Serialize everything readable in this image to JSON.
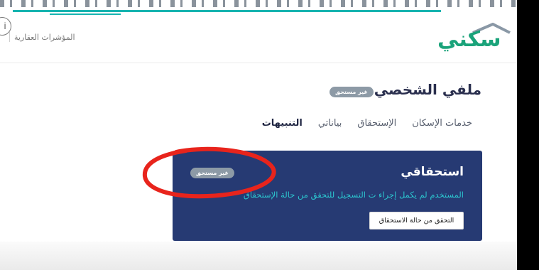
{
  "header": {
    "nav_link": "المؤشرات العقارية",
    "info_glyph": "i",
    "logo_text": "سكني"
  },
  "profile": {
    "title": "ملفي الشخصي",
    "status_badge": "غير مستحق"
  },
  "tabs": [
    {
      "label": "التنبيهات",
      "active": true
    },
    {
      "label": "بياناتي",
      "active": false
    },
    {
      "label": "الإستحقاق",
      "active": false
    },
    {
      "label": "خدمات الإسكان",
      "active": false
    }
  ],
  "eligibility_card": {
    "title": "استحقاقي",
    "status_badge": "غير مستحق",
    "message": "المستخدم لم يكمل إجراء ت التسجيل للتحقق من حالة الإستحقاق",
    "button_label": "التحقق من حالة الاستحقاق"
  },
  "colors": {
    "brand_green": "#1aa37a",
    "card_navy": "#263a73",
    "message_teal": "#2cc6cf",
    "badge_gray": "#8d9aa6",
    "annotation_red": "#e8241c"
  },
  "annotation": {
    "icon": "red-hand-drawn-circle"
  }
}
